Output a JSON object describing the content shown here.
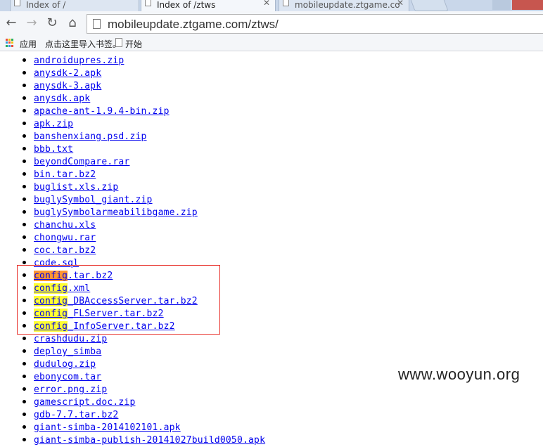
{
  "browser": {
    "tabs": [
      {
        "title": "Index of /"
      },
      {
        "title": "Index of /ztws"
      },
      {
        "title": "mobileupdate.ztgame.co"
      }
    ],
    "address": "mobileupdate.ztgame.com/ztws/"
  },
  "bookmarks_bar": {
    "apps_label": "应用",
    "import_label": "点击这里导入书签。",
    "start_label": "开始"
  },
  "listing": {
    "files": [
      {
        "parts": [
          {
            "text": "androidupres.zip"
          }
        ]
      },
      {
        "parts": [
          {
            "text": "anysdk-2.apk"
          }
        ]
      },
      {
        "parts": [
          {
            "text": "anysdk-3.apk"
          }
        ]
      },
      {
        "parts": [
          {
            "text": "anysdk.apk"
          }
        ]
      },
      {
        "parts": [
          {
            "text": "apache-ant-1.9.4-bin.zip"
          }
        ]
      },
      {
        "parts": [
          {
            "text": "apk.zip"
          }
        ]
      },
      {
        "parts": [
          {
            "text": "banshenxiang.psd.zip"
          }
        ]
      },
      {
        "parts": [
          {
            "text": "bbb.txt"
          }
        ]
      },
      {
        "parts": [
          {
            "text": "beyondCompare.rar"
          }
        ]
      },
      {
        "parts": [
          {
            "text": "bin.tar.bz2"
          }
        ]
      },
      {
        "parts": [
          {
            "text": "buglist.xls.zip"
          }
        ]
      },
      {
        "parts": [
          {
            "text": "buglySymbol_giant.zip"
          }
        ]
      },
      {
        "parts": [
          {
            "text": "buglySymbolarmeabilibgame.zip"
          }
        ]
      },
      {
        "parts": [
          {
            "text": "chanchu.xls"
          }
        ]
      },
      {
        "parts": [
          {
            "text": "chongwu.rar"
          }
        ]
      },
      {
        "parts": [
          {
            "text": "coc.tar.bz2"
          }
        ]
      },
      {
        "parts": [
          {
            "text": "code.sql"
          }
        ]
      },
      {
        "parts": [
          {
            "text": "config",
            "hl": "orange"
          },
          {
            "text": ".tar.bz2"
          }
        ]
      },
      {
        "parts": [
          {
            "text": "config",
            "hl": "yellow"
          },
          {
            "text": ".xml"
          }
        ]
      },
      {
        "parts": [
          {
            "text": "config",
            "hl": "yellow"
          },
          {
            "text": "_DBAccessServer.tar.bz2"
          }
        ]
      },
      {
        "parts": [
          {
            "text": "config",
            "hl": "yellow"
          },
          {
            "text": "_FLServer.tar.bz2"
          }
        ]
      },
      {
        "parts": [
          {
            "text": "config",
            "hl": "yellow"
          },
          {
            "text": "_InfoServer.tar.bz2"
          }
        ]
      },
      {
        "parts": [
          {
            "text": "crashdudu.zip"
          }
        ]
      },
      {
        "parts": [
          {
            "text": "deploy_simba"
          }
        ]
      },
      {
        "parts": [
          {
            "text": "dudulog.zip"
          }
        ]
      },
      {
        "parts": [
          {
            "text": "ebonycom.tar"
          }
        ]
      },
      {
        "parts": [
          {
            "text": "error.png.zip"
          }
        ]
      },
      {
        "parts": [
          {
            "text": "gamescript.doc.zip"
          }
        ]
      },
      {
        "parts": [
          {
            "text": "gdb-7.7.tar.bz2"
          }
        ]
      },
      {
        "parts": [
          {
            "text": "giant-simba-2014102101.apk"
          }
        ]
      },
      {
        "parts": [
          {
            "text": "giant-simba-publish-20141027build0050.apk"
          }
        ]
      }
    ]
  },
  "watermark": "www.wooyun.org",
  "colors": {
    "link": "#0000ee",
    "highlight_current": "#ff9632",
    "highlight_match": "#ffff33",
    "annotation_box": "#e8322c"
  }
}
